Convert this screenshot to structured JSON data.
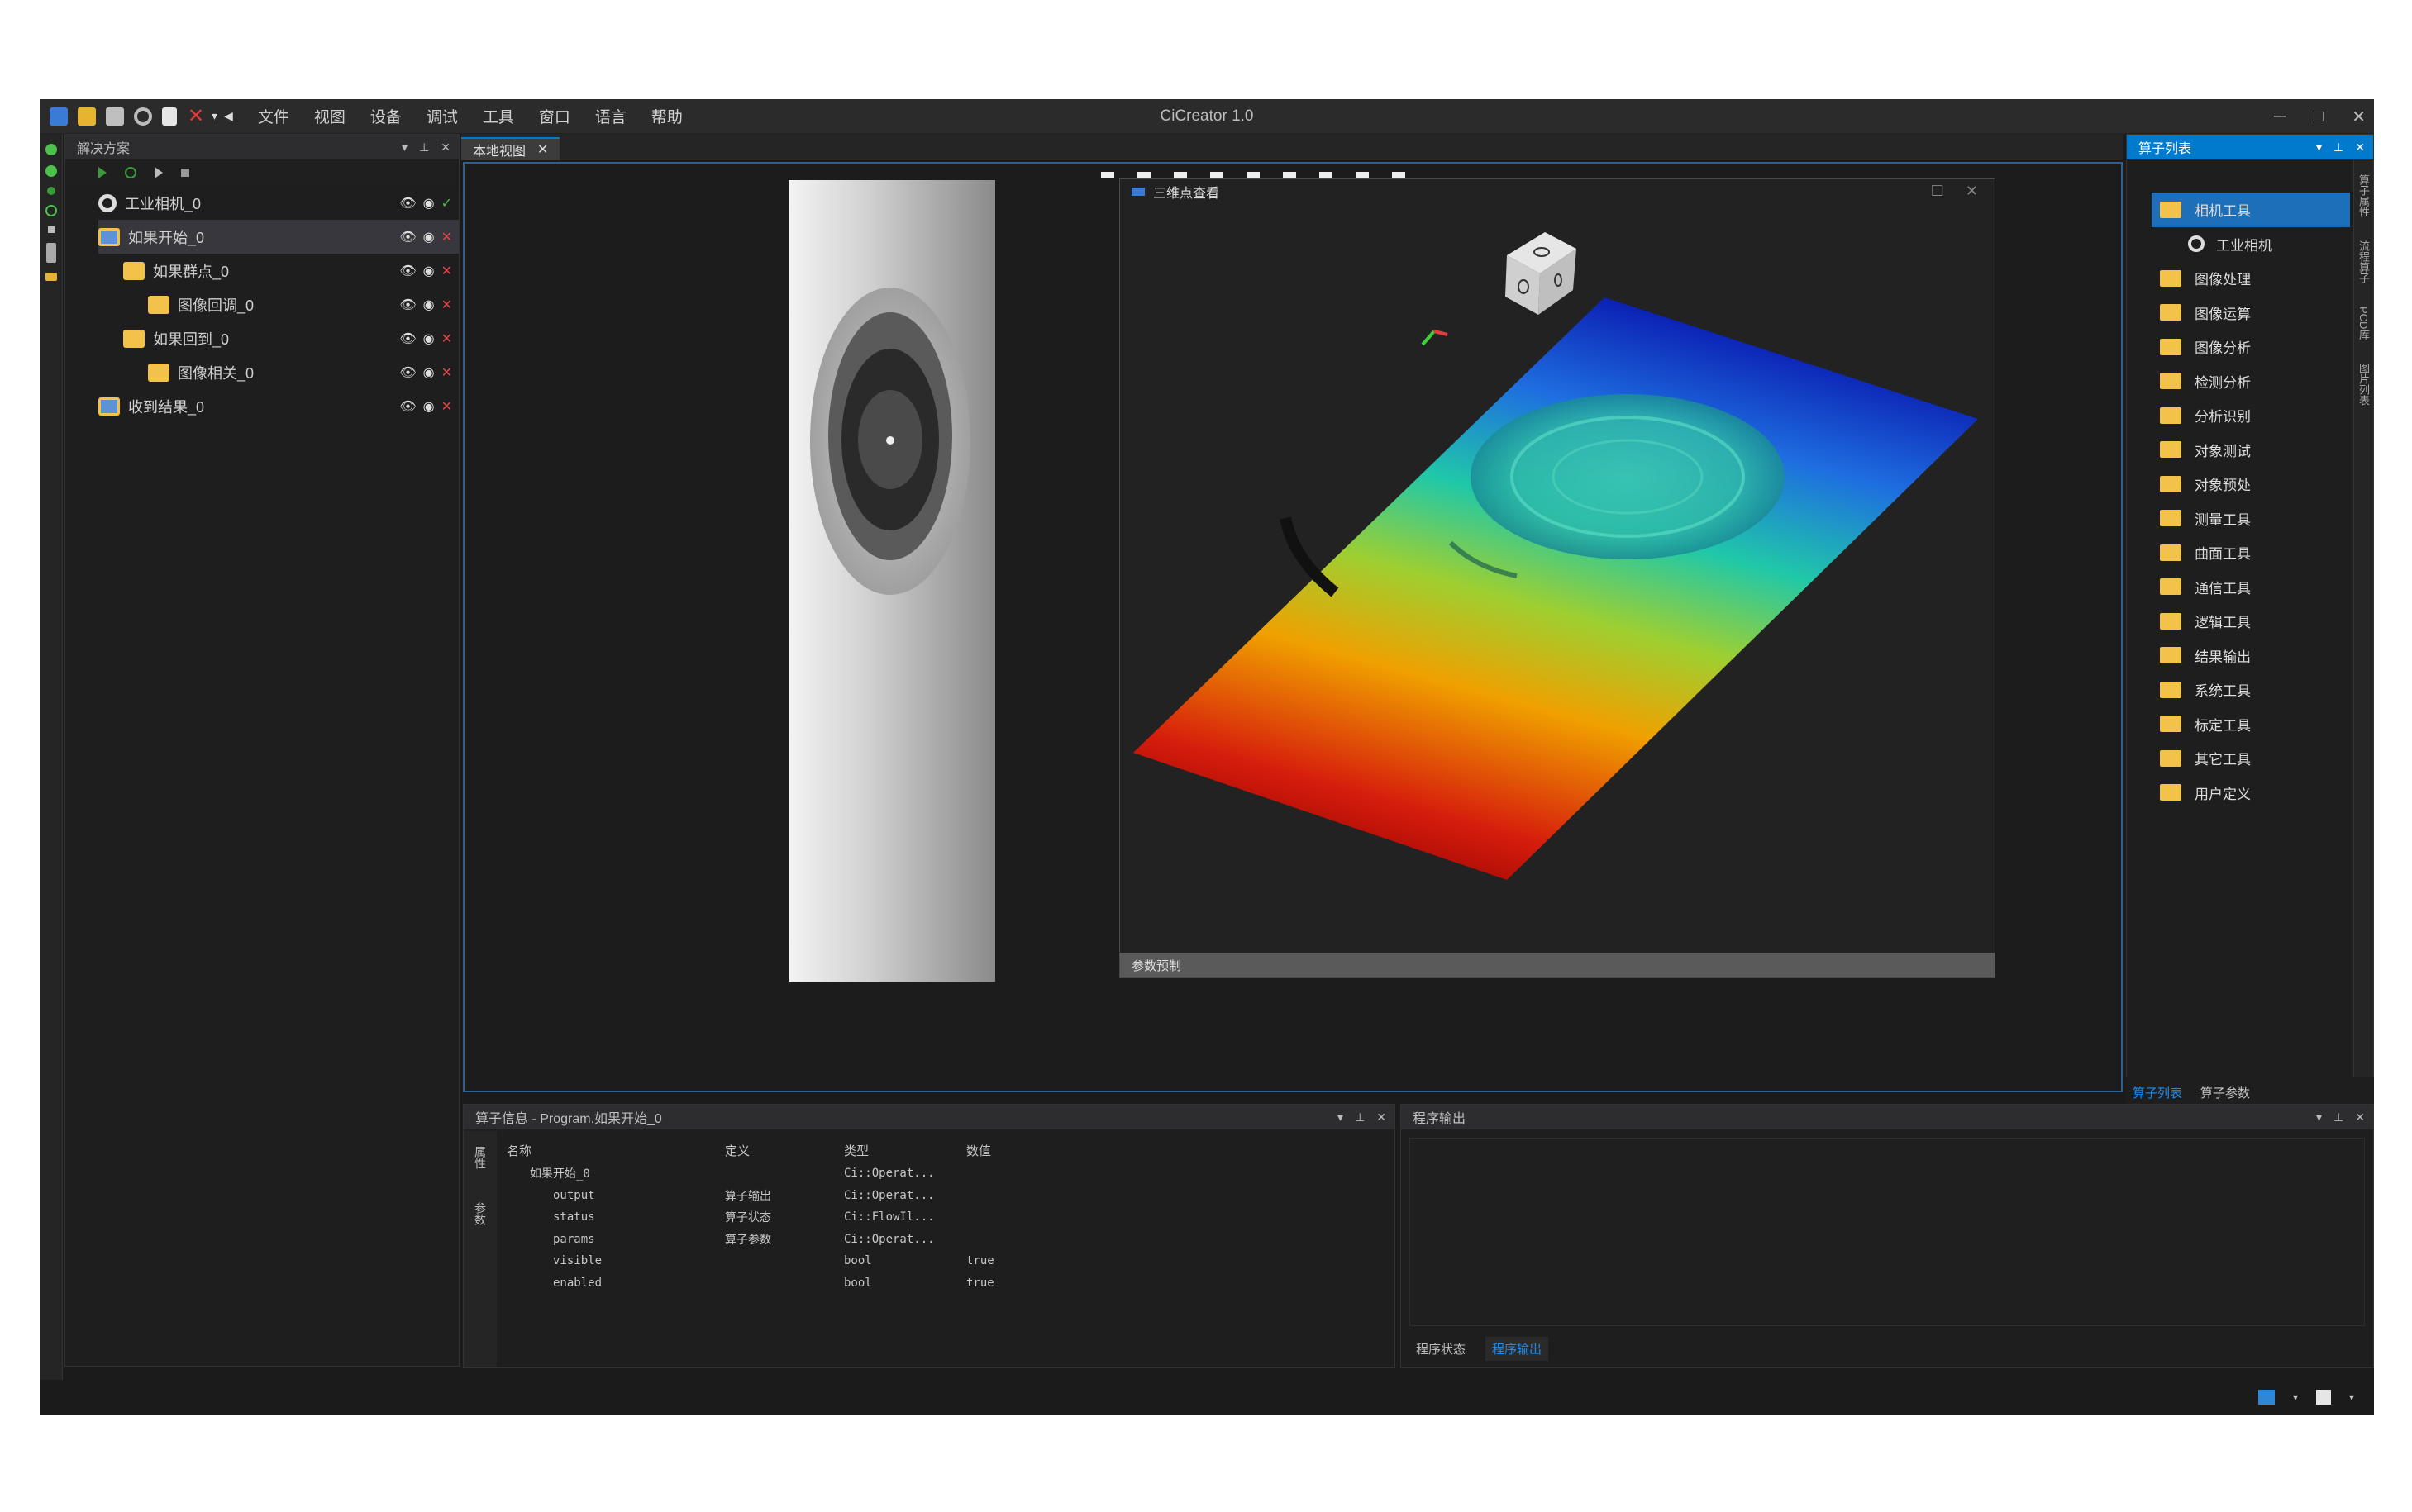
{
  "window": {
    "title": "CiCreator 1.0",
    "controls": [
      "─",
      "□",
      "✕"
    ]
  },
  "menubar": {
    "items": [
      "文件",
      "视图",
      "设备",
      "调试",
      "工具",
      "窗口",
      "语言",
      "帮助"
    ]
  },
  "solution_panel": {
    "title": "解决方案",
    "tree": [
      {
        "label": "工业相机_0",
        "icon": "camera-icon",
        "status": "ok",
        "indent": 0
      },
      {
        "label": "如果开始_0",
        "icon": "program-icon",
        "status": "error",
        "indent": 0,
        "selected": true
      },
      {
        "label": "如果群点_0",
        "icon": "folder-icon",
        "status": "error",
        "indent": 1
      },
      {
        "label": "图像回调_0",
        "icon": "folder-icon",
        "status": "error",
        "indent": 2
      },
      {
        "label": "如果回到_0",
        "icon": "folder-icon",
        "status": "error",
        "indent": 1
      },
      {
        "label": "图像相关_0",
        "icon": "folder-icon",
        "status": "error",
        "indent": 2
      },
      {
        "label": "收到结果_0",
        "icon": "program-icon",
        "status": "error",
        "indent": 0
      }
    ]
  },
  "main_tab": {
    "label": "本地视图"
  },
  "viewer_3d": {
    "title": "三维点查看",
    "footer": "参数预制"
  },
  "operator_list": {
    "title": "算子列表",
    "items": [
      {
        "label": "相机工具",
        "type": "folder",
        "selected": true
      },
      {
        "label": "工业相机",
        "type": "camera"
      },
      {
        "label": "图像处理",
        "type": "folder"
      },
      {
        "label": "图像运算",
        "type": "folder"
      },
      {
        "label": "图像分析",
        "type": "folder"
      },
      {
        "label": "检测分析",
        "type": "folder"
      },
      {
        "label": "分析识别",
        "type": "folder"
      },
      {
        "label": "对象测试",
        "type": "folder"
      },
      {
        "label": "对象预处",
        "type": "folder"
      },
      {
        "label": "测量工具",
        "type": "folder"
      },
      {
        "label": "曲面工具",
        "type": "folder"
      },
      {
        "label": "通信工具",
        "type": "folder"
      },
      {
        "label": "逻辑工具",
        "type": "folder"
      },
      {
        "label": "结果输出",
        "type": "folder"
      },
      {
        "label": "系统工具",
        "type": "folder"
      },
      {
        "label": "标定工具",
        "type": "folder"
      },
      {
        "label": "其它工具",
        "type": "folder"
      },
      {
        "label": "用户定义",
        "type": "folder"
      }
    ],
    "vertical_tabs": [
      "算子属性",
      "流程算子",
      "PCD库",
      "图片列表"
    ],
    "bottom_tabs": [
      "算子列表",
      "算子参数"
    ]
  },
  "operator_info": {
    "title": "算子信息 - Program.如果开始_0",
    "side_tabs": [
      "属性",
      "参数"
    ],
    "columns": [
      "名称",
      "定义",
      "类型",
      "数值"
    ],
    "rows": [
      [
        "如果开始_0",
        "",
        "Ci::Operat...",
        ""
      ],
      [
        "output",
        "算子输出",
        "Ci::Operat...",
        ""
      ],
      [
        "status",
        "算子状态",
        "Ci::FlowIl...",
        ""
      ],
      [
        "params",
        "算子参数",
        "Ci::Operat...",
        ""
      ],
      [
        "visible",
        "",
        "bool",
        "true"
      ],
      [
        "enabled",
        "",
        "bool",
        "true"
      ]
    ]
  },
  "program_output": {
    "title": "程序输出",
    "tabs": [
      "程序状态",
      "程序输出"
    ],
    "active_tab": "程序输出"
  },
  "colors": {
    "accent": "#007acc",
    "error": "#e24545",
    "ok": "#4cc24c",
    "folder": "#f2c24b"
  }
}
